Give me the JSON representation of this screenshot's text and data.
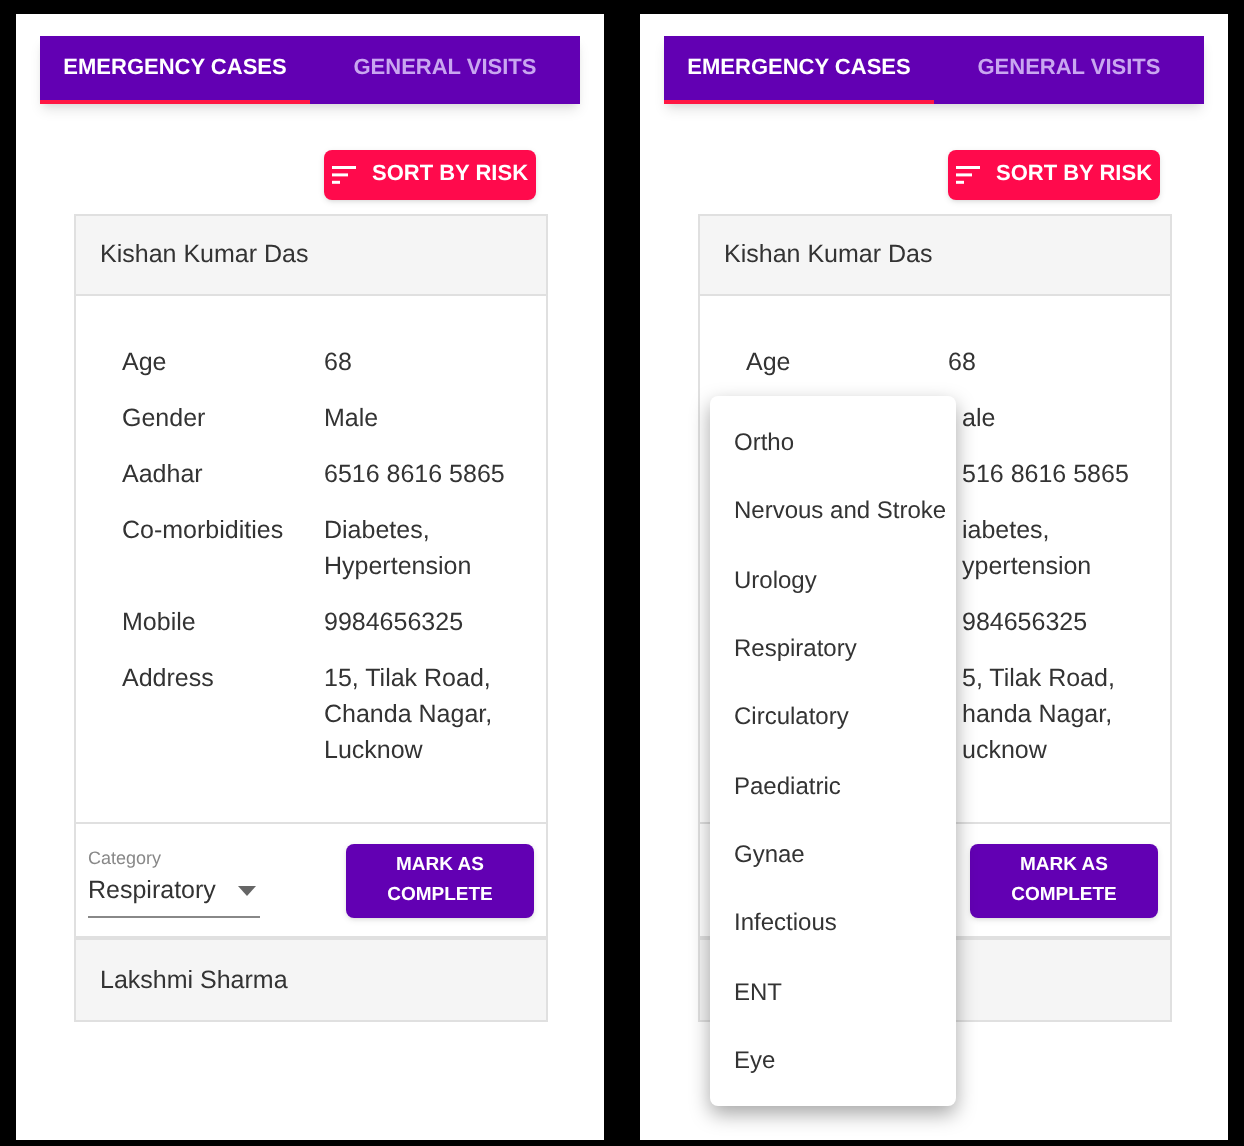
{
  "screens": [
    {
      "tabs": [
        {
          "label": "EMERGENCY CASES",
          "selected": true
        },
        {
          "label": "GENERAL VISITS",
          "selected": false
        }
      ],
      "sort_button": "SORT BY RISK",
      "cases": [
        {
          "name": "Kishan Kumar Das",
          "expanded": true,
          "details": [
            {
              "label": "Age",
              "value": "68"
            },
            {
              "label": "Gender",
              "value": "Male"
            },
            {
              "label": "Aadhar",
              "value": "6516 8616 5865"
            },
            {
              "label": "Co-morbidities",
              "value": "Diabetes,\nHypertension"
            },
            {
              "label": "Mobile",
              "value": "9984656325"
            },
            {
              "label": "Address",
              "value": "15, Tilak Road,\nChanda Nagar,\nLucknow"
            }
          ],
          "category": {
            "label": "Category",
            "value": "Respiratory"
          },
          "complete_button": "MARK AS\nCOMPLETE"
        },
        {
          "name": "Lakshmi Sharma",
          "expanded": false
        }
      ]
    },
    {
      "tabs": [
        {
          "label": "EMERGENCY CASES",
          "selected": true
        },
        {
          "label": "GENERAL VISITS",
          "selected": false
        }
      ],
      "sort_button": "SORT BY RISK",
      "cases": [
        {
          "name": "Kishan Kumar Das",
          "expanded": true,
          "details": [
            {
              "label": "Age",
              "value": "68"
            },
            {
              "value": "ale"
            },
            {
              "value": "516 8616 5865"
            },
            {
              "value": "iabetes,\nypertension"
            },
            {
              "value": "984656325"
            },
            {
              "value": "5, Tilak Road,\nhanda Nagar,\nucknow"
            }
          ],
          "complete_button": "MARK AS\nCOMPLETE"
        },
        {
          "expanded": false
        }
      ],
      "category_menu": {
        "options": [
          "Ortho",
          "Nervous and Stroke",
          "Urology",
          "Respiratory",
          "Circulatory",
          "Paediatric",
          "Gynae",
          "Infectious",
          "ENT",
          "Eye"
        ]
      }
    }
  ]
}
